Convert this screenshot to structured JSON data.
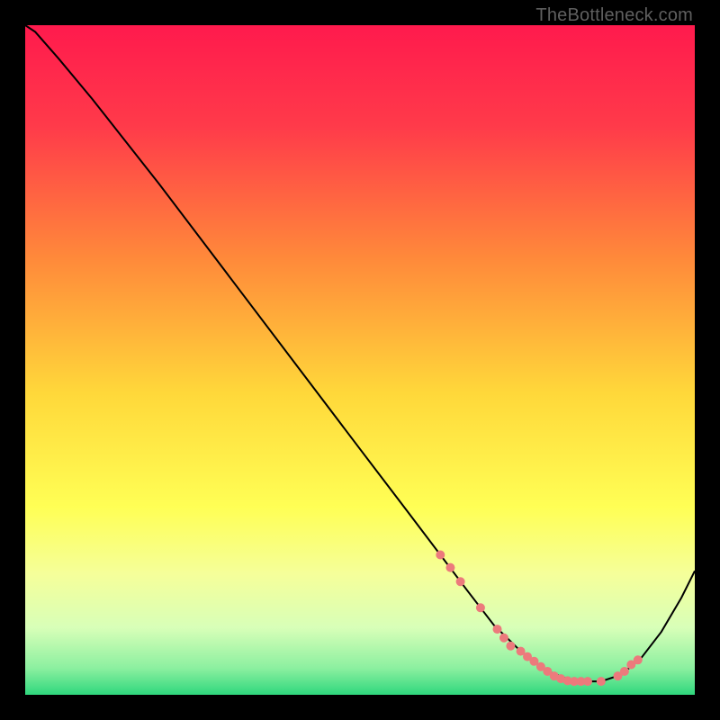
{
  "attribution": "TheBottleneck.com",
  "chart_data": {
    "type": "line",
    "title": "",
    "xlabel": "",
    "ylabel": "",
    "xlim": [
      0,
      100
    ],
    "ylim": [
      0,
      100
    ],
    "grid": false,
    "legend": false,
    "background_gradient": {
      "stops": [
        {
          "offset": 0.0,
          "color": "#ff1a4d"
        },
        {
          "offset": 0.15,
          "color": "#ff3a4a"
        },
        {
          "offset": 0.35,
          "color": "#ff8a3a"
        },
        {
          "offset": 0.55,
          "color": "#ffd83a"
        },
        {
          "offset": 0.72,
          "color": "#ffff55"
        },
        {
          "offset": 0.82,
          "color": "#f5ff9a"
        },
        {
          "offset": 0.9,
          "color": "#d8ffb8"
        },
        {
          "offset": 0.96,
          "color": "#8cf0a0"
        },
        {
          "offset": 1.0,
          "color": "#2fd77d"
        }
      ]
    },
    "series": [
      {
        "name": "bottleneck-curve",
        "color": "#000000",
        "x": [
          0.0,
          1.5,
          5.0,
          10.0,
          20.0,
          30.0,
          40.0,
          50.0,
          57.0,
          62.0,
          66.0,
          70.0,
          74.0,
          78.0,
          82.0,
          86.0,
          89.0,
          92.0,
          95.0,
          98.0,
          100.0
        ],
        "values": [
          100.0,
          99.0,
          95.0,
          89.0,
          76.3,
          63.1,
          49.9,
          36.7,
          27.5,
          20.9,
          15.6,
          10.4,
          6.5,
          3.5,
          2.0,
          2.0,
          3.0,
          5.5,
          9.4,
          14.5,
          18.5
        ]
      }
    ],
    "markers": {
      "name": "highlight-points",
      "color": "#ec7a7c",
      "radius_px": 5,
      "x": [
        62.0,
        63.5,
        65.0,
        68.0,
        70.5,
        71.5,
        72.5,
        74.0,
        75.0,
        76.0,
        77.0,
        78.0,
        79.0,
        80.0,
        81.0,
        82.0,
        83.0,
        84.0,
        86.0,
        88.5,
        89.5,
        90.5,
        91.5
      ],
      "values": [
        20.9,
        19.0,
        16.9,
        13.0,
        9.8,
        8.5,
        7.3,
        6.5,
        5.7,
        5.0,
        4.2,
        3.5,
        2.8,
        2.4,
        2.1,
        2.0,
        2.0,
        2.0,
        2.0,
        2.8,
        3.5,
        4.5,
        5.2
      ]
    }
  }
}
